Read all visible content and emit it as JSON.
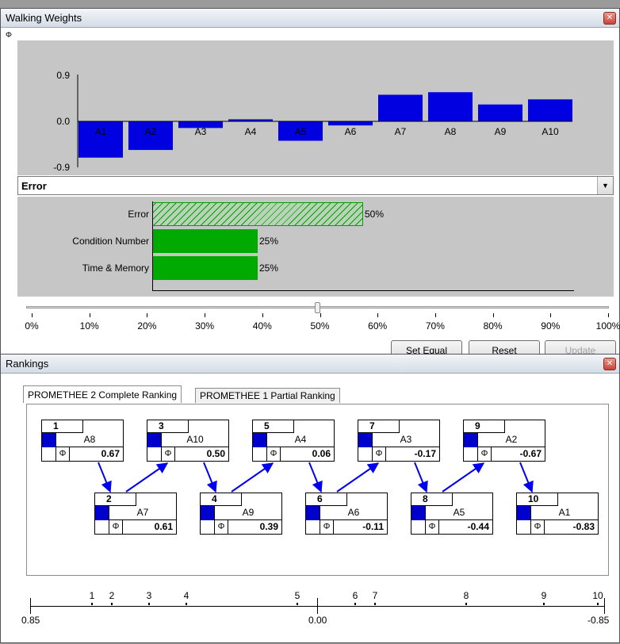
{
  "walking_window": {
    "title": "Walking Weights",
    "phi_label": "Φ",
    "close_glyph": "✕"
  },
  "chart_data": {
    "type": "bar",
    "categories": [
      "A1",
      "A2",
      "A3",
      "A4",
      "A5",
      "A6",
      "A7",
      "A8",
      "A9",
      "A10"
    ],
    "values": [
      -0.71,
      -0.56,
      -0.13,
      0.04,
      -0.38,
      -0.08,
      0.52,
      0.57,
      0.33,
      0.43
    ],
    "ylim": [
      -0.9,
      0.9
    ],
    "ytick_labels": [
      "0.9",
      "0.0",
      "-0.9"
    ],
    "bar_color": "#0000e0"
  },
  "criterion_select": {
    "value": "Error"
  },
  "weights": [
    {
      "label": "Error",
      "value": 50,
      "pct_label": "50%",
      "style": "hatched"
    },
    {
      "label": "Condition Number",
      "value": 25,
      "pct_label": "25%",
      "style": "solid"
    },
    {
      "label": "Time & Memory",
      "value": 25,
      "pct_label": "25%",
      "style": "solid"
    }
  ],
  "weight_color": "#00aa00",
  "slider": {
    "value": 50,
    "ticks": [
      "0%",
      "10%",
      "20%",
      "30%",
      "40%",
      "50%",
      "60%",
      "70%",
      "80%",
      "90%",
      "100%"
    ]
  },
  "buttons": {
    "set_equal": "Set Equal",
    "reset": "Reset",
    "update": "Update"
  },
  "rankings_window": {
    "title": "Rankings",
    "tabs": [
      "PROMETHEE 2 Complete Ranking",
      "PROMETHEE 1 Partial Ranking"
    ],
    "items": [
      {
        "rank": "1",
        "name": "A8",
        "score": "0.67"
      },
      {
        "rank": "2",
        "name": "A7",
        "score": "0.61"
      },
      {
        "rank": "3",
        "name": "A10",
        "score": "0.50"
      },
      {
        "rank": "4",
        "name": "A9",
        "score": "0.39"
      },
      {
        "rank": "5",
        "name": "A4",
        "score": "0.06"
      },
      {
        "rank": "6",
        "name": "A6",
        "score": "-0.11"
      },
      {
        "rank": "7",
        "name": "A3",
        "score": "-0.17"
      },
      {
        "rank": "8",
        "name": "A5",
        "score": "-0.44"
      },
      {
        "rank": "9",
        "name": "A2",
        "score": "-0.67"
      },
      {
        "rank": "10",
        "name": "A1",
        "score": "-0.83"
      }
    ],
    "scale": {
      "min_label": "0.85",
      "mid_label": "0.00",
      "max_label": "-0.85",
      "range": [
        0.85,
        -0.85
      ]
    }
  }
}
